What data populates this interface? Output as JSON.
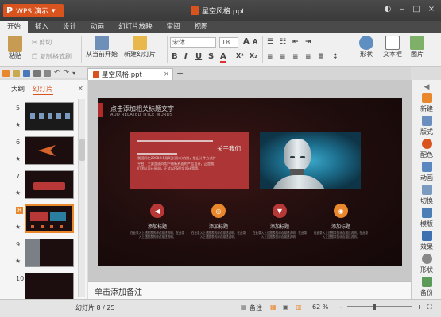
{
  "app": {
    "button_label": "WPS 演示",
    "doc_title": "星空风格.ppt"
  },
  "menu": [
    "开始",
    "插入",
    "设计",
    "动画",
    "幻灯片放映",
    "审阅",
    "视图"
  ],
  "ribbon": {
    "paste": "粘贴",
    "cut": "剪切",
    "copy": "复制",
    "format_painter": "格式刷",
    "from_current": "从当前开始",
    "new_slide": "新建幻灯片",
    "font_name": "宋体",
    "font_size": "18",
    "shape": "形状",
    "textbox": "文本框",
    "picture": "图片"
  },
  "document_tab": {
    "name": "星空风格.ppt",
    "add": "+"
  },
  "left_pane": {
    "tabs": [
      "大纲",
      "幻灯片"
    ],
    "close": "×",
    "thumbs": [
      {
        "num": "5",
        "star": "★"
      },
      {
        "num": "6",
        "star": "★"
      },
      {
        "num": "7",
        "star": "★"
      },
      {
        "num": "8",
        "star": "★"
      },
      {
        "num": "9",
        "star": "★"
      },
      {
        "num": "10",
        "star": ""
      }
    ]
  },
  "slide": {
    "title": "点击添加相关标题文字",
    "subtitle": "ADD RELATED TITLE WORDS",
    "textbox_title": "关于我们",
    "textbox_body": "我国同仁2008年5月8日(周末)内推，推出计件方式并平台，主要是面向用户最新界面的产品设计，正是我们团队设计网站，正式以PS图文设计等等。",
    "features": [
      {
        "title": "添加标题",
        "desc": "在此录入上述图表的综合描述说明，在此录入上述图表的综合描述说明。",
        "color": "#b83838",
        "icon": "◀"
      },
      {
        "title": "添加标题",
        "desc": "在此录入上述图表的综合描述说明，在此录入上述图表的综合描述说明。",
        "color": "#e8872b",
        "icon": "◎"
      },
      {
        "title": "添加标题",
        "desc": "在此录入上述图表的综合描述说明，在此录入上述图表的综合描述说明。",
        "color": "#b83838",
        "icon": "▼"
      },
      {
        "title": "添加标题",
        "desc": "在此录入上述图表的综合描述说明，在此录入上述图表的综合描述说明。",
        "color": "#e8872b",
        "icon": "◉"
      }
    ]
  },
  "notes_placeholder": "单击添加备注",
  "right_bar": [
    "新建",
    "版式",
    "配色",
    "动画",
    "切换",
    "模版",
    "效果",
    "形状",
    "备份"
  ],
  "status": {
    "slide_info": "幻灯片 8 / 25",
    "notes": "备注",
    "zoom": "62 %"
  },
  "colors": {
    "accent": "#d9531e",
    "selection": "#e8872b"
  }
}
